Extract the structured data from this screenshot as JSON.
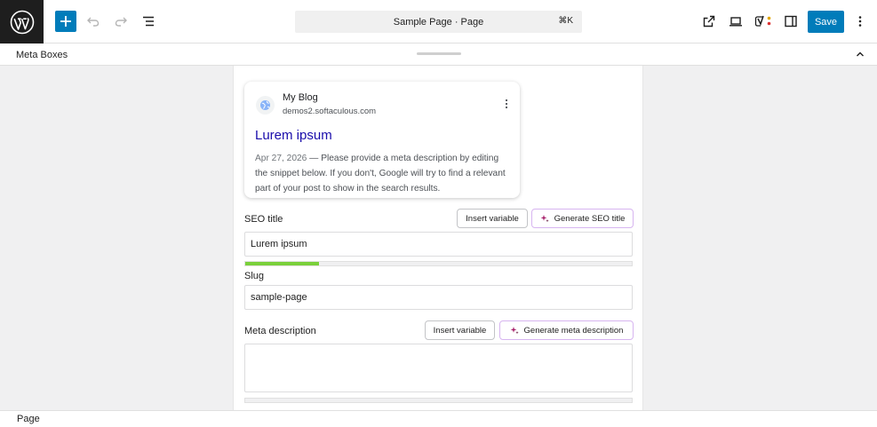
{
  "toolbar": {
    "command_bar_title": "Sample Page · Page",
    "command_bar_shortcut": "⌘K",
    "save_label": "Save"
  },
  "meta_boxes": {
    "title": "Meta Boxes"
  },
  "snippet_preview": {
    "site_name": "My Blog",
    "site_url": "demos2.softaculous.com",
    "title": "Lurem ipsum",
    "date": "Apr 27, 2026",
    "separator": " — ",
    "description": "Please provide a meta description by editing the snippet below. If you don't, Google will try to find a relevant part of your post to show in the search results."
  },
  "seo_title": {
    "label": "SEO title",
    "insert_variable_label": "Insert variable",
    "generate_label": "Generate SEO title",
    "value": "Lurem ipsum",
    "progress": 0.19
  },
  "slug": {
    "label": "Slug",
    "value": "sample-page"
  },
  "meta_description": {
    "label": "Meta description",
    "insert_variable_label": "Insert variable",
    "generate_label": "Generate meta description",
    "value": ""
  },
  "footer": {
    "breadcrumb": "Page"
  },
  "colors": {
    "accent": "#007cba",
    "progress_good": "#7ad03a",
    "snippet_title": "#1a0dab",
    "yoast_toggle": "#a4286a"
  }
}
